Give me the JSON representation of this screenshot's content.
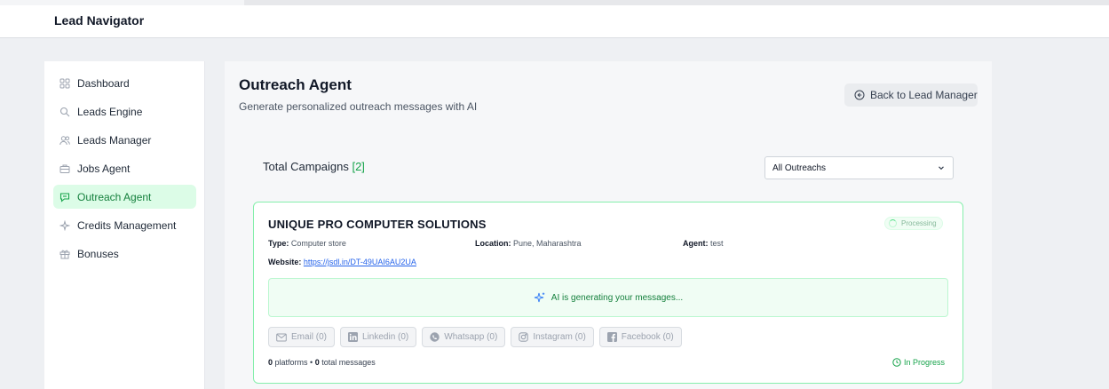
{
  "app": {
    "title": "Lead Navigator"
  },
  "sidebar": {
    "items": [
      {
        "label": "Dashboard",
        "icon": "grid-icon",
        "active": false
      },
      {
        "label": "Leads Engine",
        "icon": "search-icon",
        "active": false
      },
      {
        "label": "Leads Manager",
        "icon": "users-icon",
        "active": false
      },
      {
        "label": "Jobs Agent",
        "icon": "briefcase-icon",
        "active": false
      },
      {
        "label": "Outreach Agent",
        "icon": "message-icon",
        "active": true
      },
      {
        "label": "Credits Management",
        "icon": "sparkle-icon",
        "active": false
      },
      {
        "label": "Bonuses",
        "icon": "gift-icon",
        "active": false
      }
    ]
  },
  "main": {
    "title": "Outreach Agent",
    "subtitle": "Generate personalized outreach messages with AI",
    "back_button": "Back to Lead Manager",
    "total_label": "Total Campaigns",
    "total_count": "[2]",
    "filter": {
      "selected": "All Outreachs"
    }
  },
  "campaign": {
    "name": "UNIQUE PRO COMPUTER SOLUTIONS",
    "badge": "Processing",
    "type_label": "Type:",
    "type": "Computer store",
    "location_label": "Location:",
    "location": "Pune, Maharashtra",
    "agent_label": "Agent:",
    "agent": "test",
    "website_label": "Website:",
    "website": "https://jsdl.in/DT-49UAI6AU2UA",
    "generating": "AI is generating your messages...",
    "platforms": [
      {
        "label": "Email (0)",
        "icon": "mail-icon"
      },
      {
        "label": "Linkedin (0)",
        "icon": "linkedin-icon"
      },
      {
        "label": "Whatsapp (0)",
        "icon": "whatsapp-icon"
      },
      {
        "label": "Instagram (0)",
        "icon": "instagram-icon"
      },
      {
        "label": "Facebook (0)",
        "icon": "facebook-icon"
      }
    ],
    "platform_count": "0",
    "platform_text": "platforms •",
    "message_count": "0",
    "message_text": "total messages",
    "status": "In Progress"
  },
  "colors": {
    "accent": "#16a34a",
    "active_bg": "#dcfce7",
    "card_border": "#86efac"
  }
}
